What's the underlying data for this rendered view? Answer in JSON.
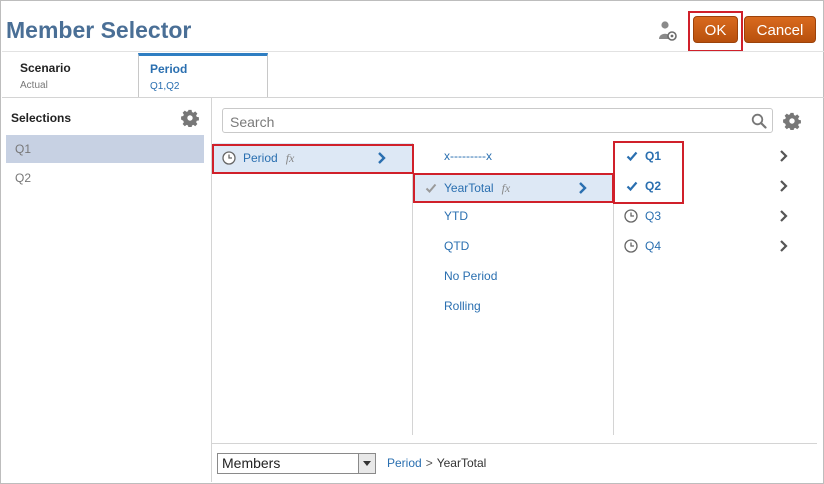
{
  "header": {
    "title": "Member Selector",
    "ok_label": "OK",
    "cancel_label": "Cancel"
  },
  "tabs": [
    {
      "title": "Scenario",
      "value": "Actual"
    },
    {
      "title": "Period",
      "value": "Q1,Q2"
    }
  ],
  "selections": {
    "title": "Selections",
    "items": [
      "Q1",
      "Q2"
    ]
  },
  "search": {
    "placeholder": "Search"
  },
  "columns": {
    "col1": [
      {
        "label": "Period",
        "fx": "fx"
      }
    ],
    "col2": [
      {
        "label": "x---------x"
      },
      {
        "label": "YearTotal",
        "fx": "fx"
      },
      {
        "label": "YTD"
      },
      {
        "label": "QTD"
      },
      {
        "label": "No Period"
      },
      {
        "label": "Rolling"
      }
    ],
    "col3": [
      {
        "label": "Q1"
      },
      {
        "label": "Q2"
      },
      {
        "label": "Q3"
      },
      {
        "label": "Q4"
      }
    ]
  },
  "footer": {
    "dropdown_value": "Members",
    "breadcrumb": {
      "parent": "Period",
      "separator": ">",
      "current": "YearTotal"
    }
  },
  "colors": {
    "accent": "#2a6fb0",
    "title": "#4a6f96",
    "button": "#c75c14",
    "highlight": "#d0202a",
    "selected_bg": "#dde8f5"
  }
}
